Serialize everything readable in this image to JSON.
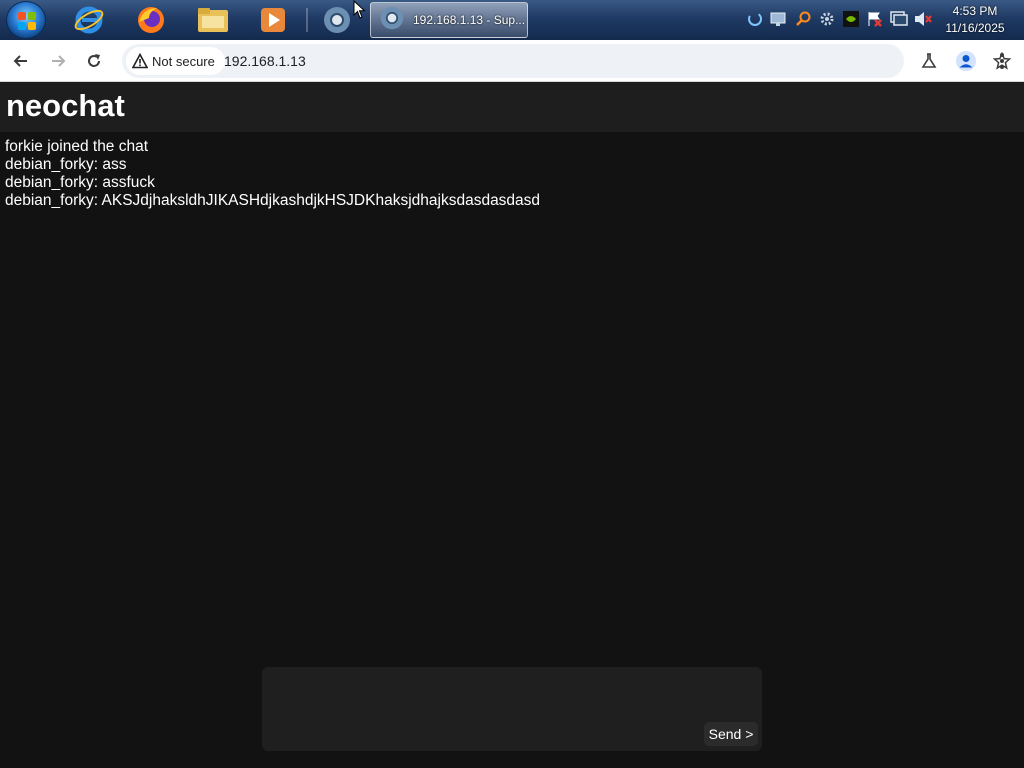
{
  "taskbar": {
    "pinned": [
      {
        "name": "internet-explorer-icon"
      },
      {
        "name": "firefox-icon"
      },
      {
        "name": "file-explorer-icon"
      },
      {
        "name": "media-player-icon"
      },
      {
        "name": "chromium-icon"
      }
    ],
    "active_task": {
      "label": "192.168.1.13 - Sup..."
    },
    "tray_icons": [
      "loading-icon",
      "network-monitor-icon",
      "search-tool-icon",
      "settings-cog-icon",
      "nvidia-icon",
      "action-center-flag-icon",
      "display-icon",
      "volume-muted-icon"
    ],
    "clock": {
      "time": "4:53 PM",
      "date": "11/16/2025"
    }
  },
  "browser": {
    "security_label": "Not secure",
    "url": "192.168.1.13"
  },
  "app": {
    "title": "neochat",
    "messages": [
      "forkie joined the chat",
      "debian_forky: ass",
      "debian_forky: assfuck",
      "debian_forky: AKSJdjhaksldhJIKASHdjkashdjkHSJDKhaksjdhajksdasdasdasd"
    ],
    "composer": {
      "value": "",
      "send_label": "Send >"
    }
  }
}
